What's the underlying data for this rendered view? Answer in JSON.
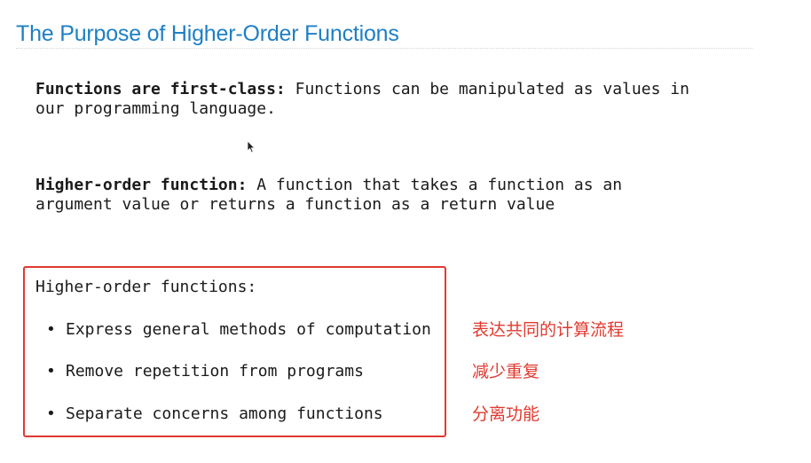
{
  "slide": {
    "title": "The Purpose of Higher-Order Functions"
  },
  "definitions": [
    {
      "term": "Functions are first-class:",
      "line1_rest": " Functions can be manipulated as values in",
      "line2": "our programming language."
    },
    {
      "term": "Higher-order function:",
      "line1_rest": " A function that takes a function as an",
      "line2": "argument value or returns a function as a return value"
    }
  ],
  "highlight_box": {
    "heading": "Higher-order functions:",
    "bullet_symbol": "•",
    "items": [
      "Express general methods of computation",
      "Remove repetition from programs",
      "Separate concerns among functions"
    ],
    "border_color": "#e03a2f"
  },
  "annotations": [
    "表达共同的计算流程",
    "减少重复",
    "分离功能"
  ],
  "colors": {
    "title": "#1f7fc4",
    "annotation": "#e03a2f",
    "body_text": "#1a1a1a"
  }
}
